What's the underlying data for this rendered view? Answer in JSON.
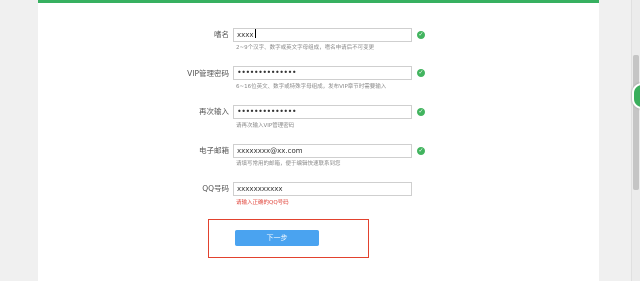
{
  "form": {
    "nickname": {
      "label": "嗜名",
      "value": "xxxx",
      "hint": "2~9个汉字、数字或英文字母组成，嗜名申请后不可变更"
    },
    "vip_password": {
      "label": "VIP管理密码",
      "value": "••••••••••••••",
      "hint": "6~16位英文、数字或特殊字母组成，发布VIP章节时需要输入"
    },
    "confirm_password": {
      "label": "再次输入",
      "value": "••••••••••••••",
      "hint": "请再次输入VIP管理密码"
    },
    "email": {
      "label": "电子邮箱",
      "value": "xxxxxxxx@xx.com",
      "hint": "请填写常用的邮箱，便于编辑快速联系到您"
    },
    "qq": {
      "label": "QQ号码",
      "value": "xxxxxxxxxxx",
      "error": "请输入正确的QQ号码"
    }
  },
  "next_button": {
    "label": "下一步"
  },
  "colors": {
    "valid_check": "#42b45f",
    "error_text": "#e0443a",
    "primary_button": "#4aa3f0",
    "highlight_border": "#e2422e"
  },
  "icons": {
    "valid": "check-circle-icon"
  }
}
